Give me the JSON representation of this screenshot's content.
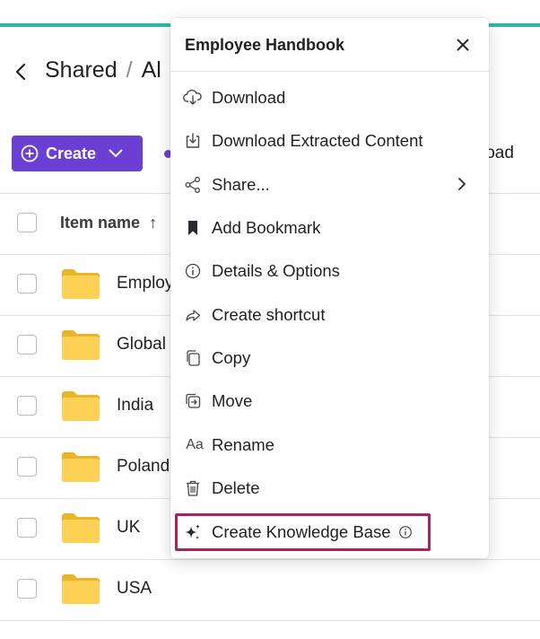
{
  "header": {
    "back_label": "<",
    "breadcrumb": {
      "parent": "Shared",
      "separator": "/",
      "current": "Al"
    }
  },
  "toolbar": {
    "create_label": "Create",
    "upload_fragment": "load"
  },
  "table": {
    "column_item_name": "Item name",
    "sort_indicator": "↑",
    "rows": [
      {
        "name": "Employ",
        "icon": "folder-icon"
      },
      {
        "name": "Global",
        "icon": "folder-icon"
      },
      {
        "name": "India",
        "icon": "folder-icon"
      },
      {
        "name": "Poland",
        "icon": "folder-icon"
      },
      {
        "name": "UK",
        "icon": "folder-icon"
      },
      {
        "name": "USA",
        "icon": "folder-icon"
      }
    ]
  },
  "context_menu": {
    "title": "Employee Handbook",
    "close_icon": "close-icon",
    "items": [
      {
        "label": "Download",
        "icon": "cloud-download-icon"
      },
      {
        "label": "Download Extracted Content",
        "icon": "download-tray-icon"
      },
      {
        "label": "Share...",
        "icon": "share-icon",
        "has_submenu": true
      },
      {
        "label": "Add Bookmark",
        "icon": "bookmark-icon"
      },
      {
        "label": "Details & Options",
        "icon": "info-icon"
      },
      {
        "label": "Create shortcut",
        "icon": "shortcut-arrow-icon"
      },
      {
        "label": "Copy",
        "icon": "copy-icon"
      },
      {
        "label": "Move",
        "icon": "move-icon"
      },
      {
        "label": "Rename",
        "icon": "rename-icon",
        "icon_text": "Aa"
      },
      {
        "label": "Delete",
        "icon": "trash-icon"
      },
      {
        "label": "Create Knowledge Base",
        "icon": "sparkle-icon",
        "highlighted": true
      }
    ]
  },
  "colors": {
    "accent_bar": "#2bb8ae",
    "primary": "#6b3fd4",
    "folder": "#fdd155",
    "highlight_border": "#a3245e"
  }
}
